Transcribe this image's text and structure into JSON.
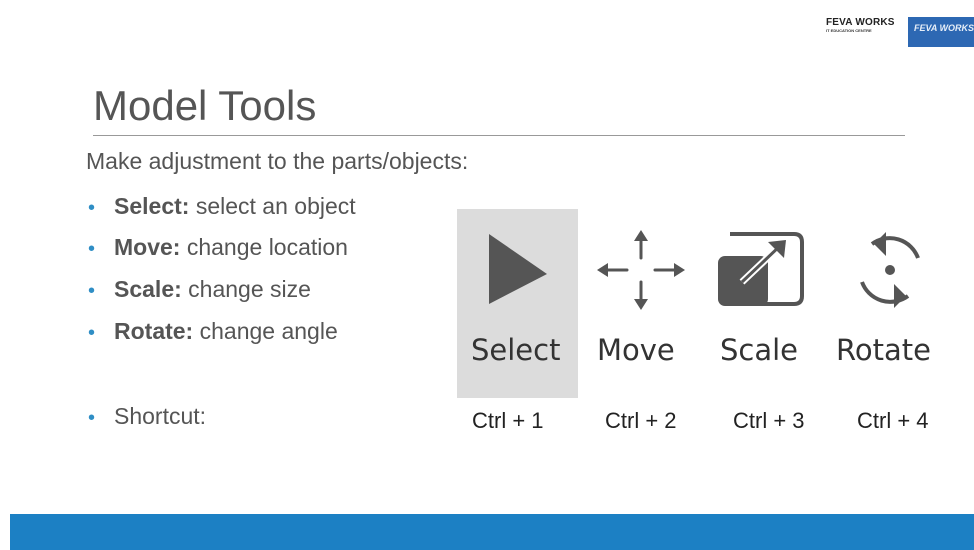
{
  "logo": {
    "name": "FEVA WORKS",
    "sub": "IT EDUCATION CENTRE",
    "box_text": "FEVA WORKS"
  },
  "slide": {
    "title": "Model Tools",
    "subtitle": "Make adjustment to the parts/objects:",
    "bullets": [
      {
        "term": "Select:",
        "desc": " select an object"
      },
      {
        "term": "Move:",
        "desc": " change location"
      },
      {
        "term": "Scale:",
        "desc": " change size"
      },
      {
        "term": "Rotate:",
        "desc": " change angle"
      }
    ],
    "shortcut_label": "Shortcut:"
  },
  "tools": [
    {
      "label": "Select",
      "icon": "cursor-arrow-icon",
      "shortcut": "Ctrl + 1",
      "selected": true
    },
    {
      "label": "Move",
      "icon": "move-arrows-icon",
      "shortcut": "Ctrl + 2",
      "selected": false
    },
    {
      "label": "Scale",
      "icon": "scale-icon",
      "shortcut": "Ctrl + 3",
      "selected": false
    },
    {
      "label": "Rotate",
      "icon": "rotate-icon",
      "shortcut": "Ctrl + 4",
      "selected": false
    }
  ],
  "colors": {
    "accent": "#1c80c4",
    "bullet": "#2f8ec5",
    "icon": "#555555",
    "highlight": "#dcdcdc"
  }
}
